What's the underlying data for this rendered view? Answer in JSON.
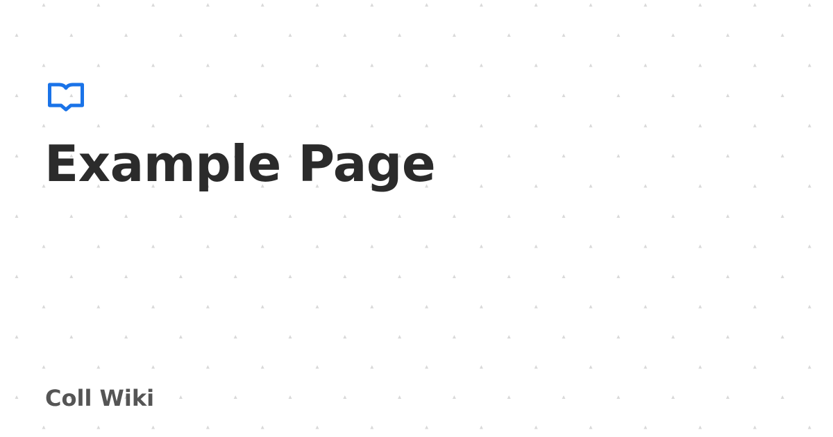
{
  "page": {
    "title": "Example Page",
    "site_name": "Coll Wiki"
  },
  "logo": {
    "icon": "book-icon"
  },
  "colors": {
    "accent": "#1a73e8",
    "title": "#2b2b2b",
    "site_name": "#555555",
    "background": "#ffffff",
    "dot": "#d9d9d9"
  }
}
